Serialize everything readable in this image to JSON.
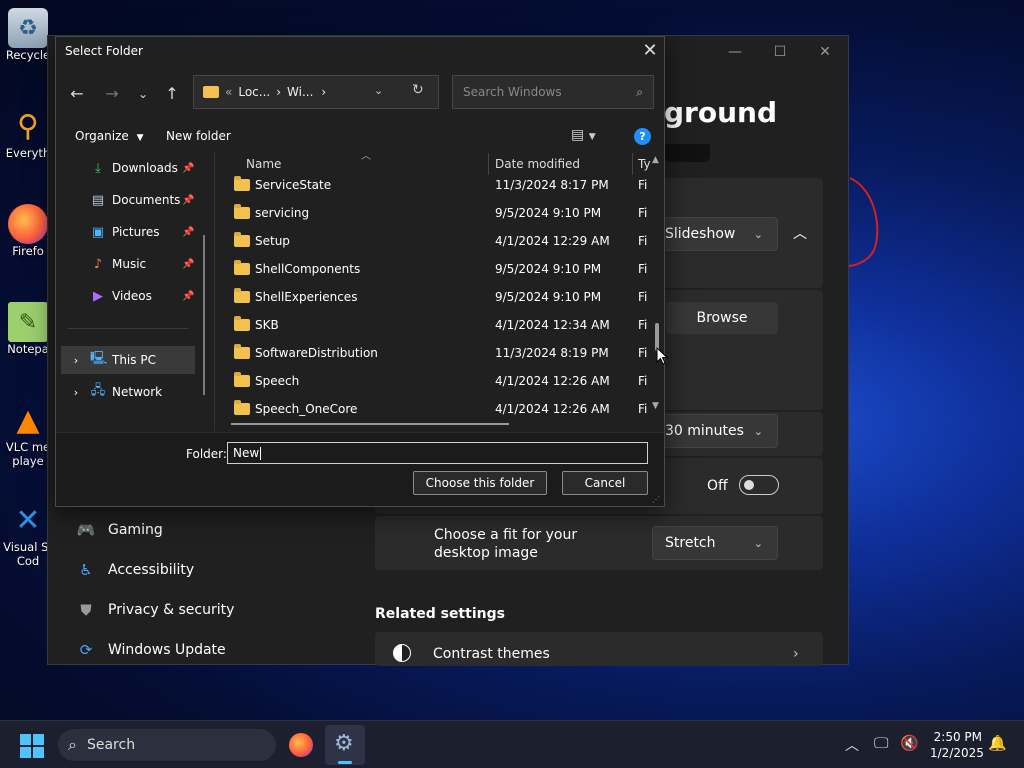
{
  "desktop": {
    "icons": [
      {
        "label": "Recycle",
        "icon": "recycle-bin-icon"
      },
      {
        "label": "Everyth",
        "icon": "everything-search-icon"
      },
      {
        "label": "Firefo",
        "icon": "firefox-icon"
      },
      {
        "label": "Notepa",
        "icon": "notepad-icon"
      },
      {
        "label": "VLC me",
        "label2": "playe",
        "icon": "vlc-icon"
      },
      {
        "label": "Visual St",
        "label2": "Cod",
        "icon": "vscode-icon"
      }
    ]
  },
  "settings": {
    "heading": "ground",
    "background_type": "Slideshow",
    "browse_label": "Browse",
    "interval": "30 minutes",
    "shuffle_state": "Off",
    "fit_label": "Choose a fit for your desktop image",
    "fit_value": "Stretch",
    "related_heading": "Related settings",
    "contrast_themes": "Contrast themes",
    "sidebar": [
      {
        "label": "Gaming"
      },
      {
        "label": "Accessibility"
      },
      {
        "label": "Privacy & security"
      },
      {
        "label": "Windows Update"
      }
    ]
  },
  "dialog": {
    "title": "Select Folder",
    "address": {
      "prefix": "«",
      "seg1": "Loc...",
      "seg2": "Wi..."
    },
    "search_placeholder": "Search Windows",
    "organize_label": "Organize",
    "new_folder_label": "New folder",
    "nav_tree": [
      {
        "label": "Downloads",
        "pinned": true
      },
      {
        "label": "Documents",
        "pinned": true
      },
      {
        "label": "Pictures",
        "pinned": true
      },
      {
        "label": "Music",
        "pinned": true
      },
      {
        "label": "Videos",
        "pinned": true
      },
      {
        "label": "This PC",
        "selected": true
      },
      {
        "label": "Network"
      }
    ],
    "columns": {
      "name": "Name",
      "date": "Date modified",
      "type": "Ty"
    },
    "rows": [
      {
        "name": "ServiceState",
        "date": "11/3/2024 8:17 PM",
        "type": "Fi"
      },
      {
        "name": "servicing",
        "date": "9/5/2024 9:10 PM",
        "type": "Fi"
      },
      {
        "name": "Setup",
        "date": "4/1/2024 12:29 AM",
        "type": "Fi"
      },
      {
        "name": "ShellComponents",
        "date": "9/5/2024 9:10 PM",
        "type": "Fi"
      },
      {
        "name": "ShellExperiences",
        "date": "9/5/2024 9:10 PM",
        "type": "Fi"
      },
      {
        "name": "SKB",
        "date": "4/1/2024 12:34 AM",
        "type": "Fi"
      },
      {
        "name": "SoftwareDistribution",
        "date": "11/3/2024 8:19 PM",
        "type": "Fi"
      },
      {
        "name": "Speech",
        "date": "4/1/2024 12:26 AM",
        "type": "Fi"
      },
      {
        "name": "Speech_OneCore",
        "date": "4/1/2024 12:26 AM",
        "type": "Fi"
      }
    ],
    "folder_label": "Folder:",
    "folder_value": "New",
    "choose_label": "Choose this folder",
    "cancel_label": "Cancel"
  },
  "taskbar": {
    "search_label": "Search",
    "time": "2:50 PM",
    "date": "1/2/2025"
  },
  "colors": {
    "accent": "#0067c0",
    "folder": "#f2c14e",
    "help": "#1e90ff"
  }
}
